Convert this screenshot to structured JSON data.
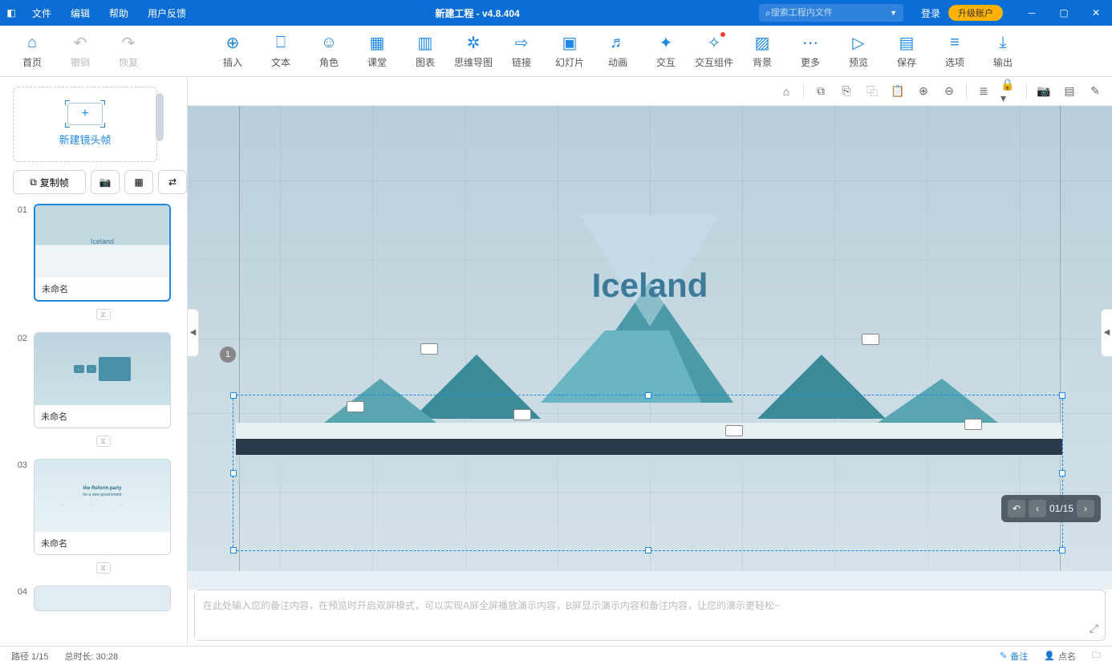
{
  "title": "新建工程 - v4.8.404",
  "menus": [
    "文件",
    "编辑",
    "帮助",
    "用户反馈"
  ],
  "search_placeholder": "搜索工程内文件",
  "login": "登录",
  "upgrade": "升级账户",
  "toolbar": {
    "home": "首页",
    "undo": "撤销",
    "redo": "恢复",
    "insert": "插入",
    "text": "文本",
    "character": "角色",
    "classroom": "课堂",
    "chart": "图表",
    "mindmap": "思维导图",
    "link": "链接",
    "slide": "幻灯片",
    "animation": "动画",
    "interact": "交互",
    "interactComp": "交互组件",
    "background": "背景",
    "more": "更多",
    "preview": "预览",
    "save": "保存",
    "options": "选项",
    "export": "输出"
  },
  "sidebar": {
    "new_slide": "新建镜头帧",
    "copy_frame": "复制帧",
    "slides": [
      {
        "num": "01",
        "label": "未命名"
      },
      {
        "num": "02",
        "label": "未命名"
      },
      {
        "num": "03",
        "label": "未命名"
      },
      {
        "num": "04",
        "label": ""
      }
    ]
  },
  "canvas": {
    "title": "Iceland",
    "marker": "1",
    "nav_pos": "01/15",
    "thumb3_title": "the Reform party",
    "thumb3_sub": "for a new government"
  },
  "notes_placeholder": "在此处输入您的备注内容，在预览时开启双屏模式，可以实现A屏全屏播放演示内容，B屏显示演示内容和备注内容，让您的演示更轻松~",
  "status": {
    "path": "路径 1/15",
    "duration": "总时长: 30:28",
    "notes": "备注",
    "rollcall": "点名"
  }
}
